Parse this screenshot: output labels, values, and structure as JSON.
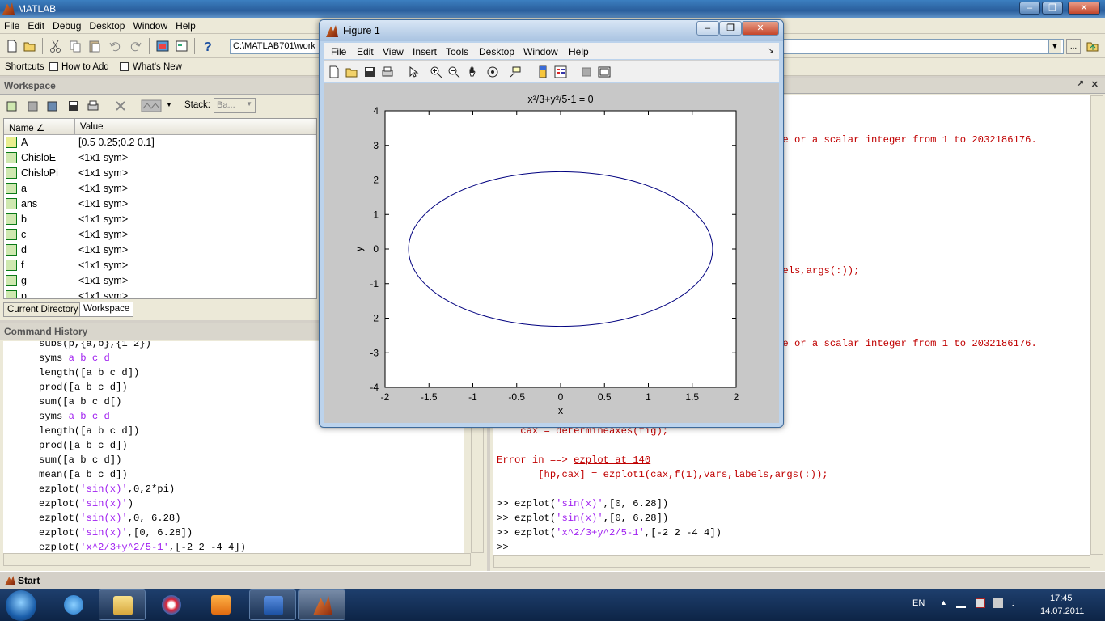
{
  "app": {
    "title": "MATLAB"
  },
  "menu": [
    "File",
    "Edit",
    "Debug",
    "Desktop",
    "Window",
    "Help"
  ],
  "current_directory": "C:\\MATLAB701\\work",
  "shortcuts": {
    "label": "Shortcuts",
    "how_to_add": "How to Add",
    "whats_new": "What's New"
  },
  "workspace": {
    "title": "Workspace",
    "stack_label": "Stack:",
    "stack_value": "Ba...",
    "columns": {
      "name": "Name ∠",
      "value": "Value"
    },
    "rows": [
      {
        "name": "A",
        "value": "[0.5 0.25;0.2 0.1]"
      },
      {
        "name": "ChisloE",
        "value": "<1x1 sym>"
      },
      {
        "name": "ChisloPi",
        "value": "<1x1 sym>"
      },
      {
        "name": "a",
        "value": "<1x1 sym>"
      },
      {
        "name": "ans",
        "value": "<1x1 sym>"
      },
      {
        "name": "b",
        "value": "<1x1 sym>"
      },
      {
        "name": "c",
        "value": "<1x1 sym>"
      },
      {
        "name": "d",
        "value": "<1x1 sym>"
      },
      {
        "name": "f",
        "value": "<1x1 sym>"
      },
      {
        "name": "g",
        "value": "<1x1 sym>"
      },
      {
        "name": "p",
        "value": "<1x1 sym>"
      }
    ],
    "tabs": [
      "Current Directory",
      "Workspace"
    ]
  },
  "command_history": {
    "title": "Command History",
    "lines": [
      "subs(p,{a,b},{1 2})",
      "syms a b c d",
      "length([a b c d])",
      "prod([a b c d])",
      "sum([a b c d[)",
      "syms a b c d",
      "length([a b c d])",
      "prod([a b c d])",
      "sum([a b c d])",
      "mean([a b c d])",
      "ezplot('sin(x)',0,2*pi)",
      "ezplot('sin(x)')",
      "ezplot('sin(x)',0, 6.28)",
      "ezplot('sin(x)',[0, 6.28])",
      "ezplot('x^2/3+y^2/5-1',[-2 2 -4 4])"
    ]
  },
  "command_window": {
    "err1": "le or a scalar integer from 1 to 2032186176.",
    "err2": "bels,args(:));",
    "err3": "le or a scalar integer from 1 to 2032186176.",
    "cax_line": "    cax = determineaxes(fig);",
    "error_in": "Error in ==> ",
    "error_link": "ezplot at 140",
    "error_code": "       [hp,cax] = ezplot1(cax,f(1),vars,labels,args(:));",
    "prompt": ">>",
    "cmd1_pre": "ezplot(",
    "cmd1_str": "'sin(x)'",
    "cmd1_post": ",[0, 6.28])",
    "cmd2_pre": "ezplot(",
    "cmd2_str": "'sin(x)'",
    "cmd2_post": ",[0, 6.28])",
    "cmd3_pre": "ezplot(",
    "cmd3_str": "'x^2/3+y^2/5-1'",
    "cmd3_post": ",[-2 2 -4 4])"
  },
  "figure": {
    "title": "Figure 1",
    "menu": [
      "File",
      "Edit",
      "View",
      "Insert",
      "Tools",
      "Desktop",
      "Window",
      "Help"
    ]
  },
  "chart_data": {
    "type": "line",
    "title": "x²/3+y²/5-1 = 0",
    "xlabel": "x",
    "ylabel": "y",
    "xlim": [
      -2,
      2
    ],
    "ylim": [
      -4,
      4
    ],
    "xticks": [
      -2,
      -1.5,
      -1,
      -0.5,
      0,
      0.5,
      1,
      1.5,
      2
    ],
    "yticks": [
      -4,
      -3,
      -2,
      -1,
      0,
      1,
      2,
      3,
      4
    ],
    "series": [
      {
        "equation": "x^2/3+y^2/5-1 = 0",
        "semi_axis_x": 1.732,
        "semi_axis_y": 2.236,
        "color": "#00007f"
      }
    ],
    "grid": false
  },
  "start": {
    "label": "Start"
  },
  "tray": {
    "lang": "EN",
    "time": "17:45",
    "date": "14.07.2011"
  },
  "colors": {
    "error": "#c00000",
    "string": "#a020f0",
    "plot_line": "#00007f"
  }
}
